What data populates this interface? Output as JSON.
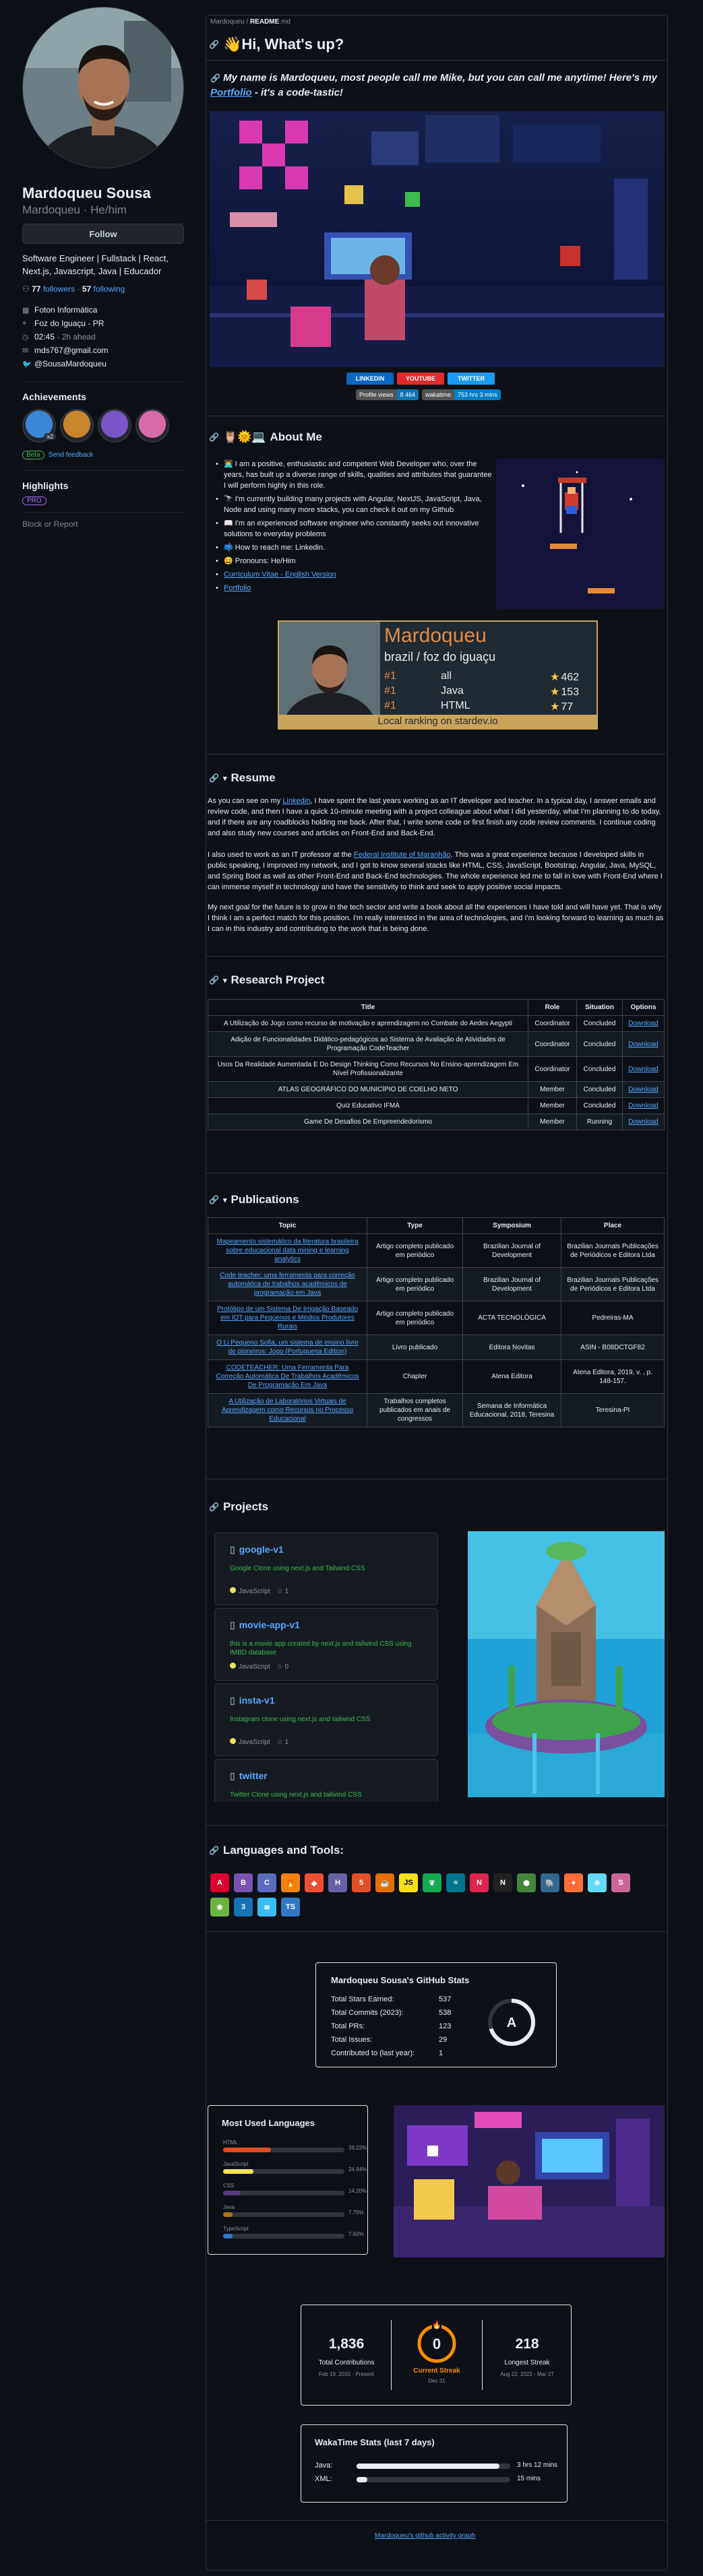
{
  "profile": {
    "name": "Mardoqueu Sousa",
    "login": "Mardoqueu · He/him",
    "follow_label": "Follow",
    "bio": "Software Engineer | Fullstack | React, Next.js, Javascript, Java | Educador",
    "followers": "77",
    "followers_label": "followers",
    "following": "57",
    "following_label": "following",
    "company": "Foton Informática",
    "location": "Foz do Iguaçu - PR",
    "time": "02:45",
    "time_note": "- 2h ahead",
    "email": "mds767@gmail.com",
    "twitter": "@SousaMardoqueu",
    "achievements_title": "Achievements",
    "achievement_badges": [
      {
        "name": "pull-shark",
        "count": "x2",
        "color": "#3a87d6"
      },
      {
        "name": "yolo",
        "count": "",
        "color": "#c7862d"
      },
      {
        "name": "quickdraw",
        "count": "",
        "color": "#7b56c8"
      },
      {
        "name": "starstruck",
        "count": "",
        "color": "#d86aa9"
      }
    ],
    "beta_label": "Beta",
    "feedback_label": "Send feedback",
    "highlights_title": "Highlights",
    "pro_label": "PRO",
    "report_label": "Block or Report"
  },
  "readme": {
    "breadcrumb_user": "Mardoqueu",
    "breadcrumb_sep": " / ",
    "breadcrumb_file": "README",
    "breadcrumb_ext": ".md",
    "title": "👋Hi, What's up?",
    "intro_a": "My name is Mardoqueu, most people call me Mike, but you can call me anytime! Here's my ",
    "intro_link": "Portfolio",
    "intro_b": " - it's a code-tastic!",
    "social": [
      {
        "label": "LINKEDIN",
        "color": "#0a66c2"
      },
      {
        "label": "YOUTUBE",
        "color": "#e02b2b"
      },
      {
        "label": "TWITTER",
        "color": "#1d9bf0"
      }
    ],
    "profile_views_label": "Profile views",
    "profile_views_value": "8 464",
    "wakatime_label": "wakatime",
    "wakatime_value": "753 hrs 3 mins"
  },
  "about": {
    "title": "About Me",
    "items": [
      "👨‍💻 I am a positive, enthusiastic and competent Web Developer who, over the years, has built up a diverse range of skills, qualities and attributes that guarantee I will perform highly in this role.",
      "🔭 I'm currently building many projects with Angular, NextJS, JavaScript, Java, Node and using many more stacks, you can check it out on my Github",
      "📖 I'm an experienced software engineer who constantly seeks out innovative solutions to everyday problems",
      "📫 How to reach me: Linkedin.",
      "😄 Pronouns: He/Him",
      "Curriculum Vitae - English Version",
      "Portfolio"
    ],
    "stardev": {
      "name": "Mardoqueu",
      "location": "brazil / foz do iguaçu",
      "rows": [
        {
          "rank": "#1",
          "lang": "all",
          "count": "462"
        },
        {
          "rank": "#1",
          "lang": "Java",
          "count": "153"
        },
        {
          "rank": "#1",
          "lang": "HTML",
          "count": "77"
        }
      ],
      "footer": "Local ranking on stardev.io"
    }
  },
  "resume": {
    "title": "Resume",
    "p1_a": "As you can see on my ",
    "p1_link": "Linkedin",
    "p1_b": ", I have spent the last years working as an IT developer and teacher. In a typical day, I answer emails and review code, and then I have a quick 10-minute meeting with a project colleague about what I did yesterday, what I'm planning to do today, and if there are any roadblocks holding me back. After that, I write some code or first finish any code review comments. I continue coding and also study new courses and articles on Front-End and Back-End.",
    "p2_a": "I also used to work as an IT professor at the ",
    "p2_link": "Federal Institute of Maranhão",
    "p2_b": ". This was a great experience because I developed skills in public speaking, I improved my network, and I got to know several stacks like HTML, CSS, JavaScript, Bootstrap, Angular, Java, MySQL, and Spring Boot as well as other Front-End and Back-End technologies. The whole experience led me to fall in love with Front-End where I can immerse myself in technology and have the sensitivity to think and seek to apply positive social impacts.",
    "p3": "My next goal for the future is to grow in the tech sector and write a book about all the experiences I have told and will have yet. That is why I think I am a perfect match for this position. I'm really interested in the area of technologies, and I'm looking forward to learning as much as I can in this industry and contributing to the work that is being done."
  },
  "research": {
    "title": "Research Project",
    "headers": [
      "Title",
      "Role",
      "Situation",
      "Options"
    ],
    "rows": [
      [
        "A Utilização do Jogo como recurso de motivação e aprendizagem no Combate do Aedes Aegypti",
        "Coordinator",
        "Concluded",
        "Download"
      ],
      [
        "Adição de Funcionalidades Didático-pedagógicos ao Sistema de Avaliação de Atividades de Programação CodeTeacher",
        "Coordinator",
        "Concluded",
        "Download"
      ],
      [
        "Usos Da Realidade Aumentada E Do Design Thinking Como Recursos No Ensino-aprendizagem Em Nível Profissionalizante",
        "Coordinator",
        "Concluded",
        "Download"
      ],
      [
        "ATLAS GEOGRÁFICO DO MUNICÍPIO DE COELHO NETO",
        "Member",
        "Concluded",
        "Download"
      ],
      [
        "Quiz Educativo IFMA",
        "Member",
        "Concluded",
        "Download"
      ],
      [
        "Game De Desafios De Empreendedorismo",
        "Member",
        "Running",
        "Download"
      ]
    ]
  },
  "publications": {
    "title": "Publications",
    "headers": [
      "Topic",
      "Type",
      "Symposium",
      "Place"
    ],
    "rows": [
      [
        "Mapeamento sistemático da literatura brasileira sobre educacional data mining e learning analytics",
        "Artigo completo publicado em periódico",
        "Brazilian Journal of Development",
        "Brazilian Journals Publicações de Periódicos e Editora Ltda"
      ],
      [
        "Code teacher: uma ferramenta para correção automática de trabalhos acadêmicos de programação em Java",
        "Artigo completo publicado em periódico",
        "Brazilian Journal of Development",
        "Brazilian Journals Publicações de Periódicos e Editora Ltda"
      ],
      [
        "Protótipo de um Sistema De Irrigação Baseado em IOT para Pequenos e Médios Produtores Rurais",
        "Artigo completo publicado em periódico",
        "ACTA TECNOLÓGICA",
        "Pedreiras-MA"
      ],
      [
        "O Li Pequeno Sofia, um sistema de ensino livre de pioneiros: Jogo (Portuguesa Edition)",
        "Livro publicado",
        "Editora Novitas",
        "ASIN - B08DCTGF82"
      ],
      [
        "CODETEACHER: Uma Ferramenta Para Correção Automática De Trabalhos Acadêmicos De Programação Em Java",
        "Chapter",
        "Atena Editora",
        "Atena Editora, 2019, v. , p. 148-157."
      ],
      [
        "A Utilização de Laboratórios Virtuais de Aprendizagem como Recursos no Processo Educacional",
        "Trabalhos completos publicados em anais de congressos",
        "Semana de Informática Educacional, 2018, Teresina",
        "Teresina-PI"
      ]
    ]
  },
  "projects": {
    "title": "Projects",
    "cards": [
      {
        "name": "google-v1",
        "desc": "Google Clone using next.js and Tailwind CSS",
        "lang": "JavaScript",
        "stars": "1"
      },
      {
        "name": "movie-app-v1",
        "desc": "this is a movie app created by next.js and tailwind CSS using IMBD database",
        "lang": "JavaScript",
        "stars": "0"
      },
      {
        "name": "insta-v1",
        "desc": "Instagram clone using next.js and tailwind CSS",
        "lang": "JavaScript",
        "stars": "1"
      },
      {
        "name": "twitter",
        "desc": "Twitter Clone using next.js and tailwind CSS",
        "lang": "",
        "stars": ""
      }
    ]
  },
  "tools": {
    "title": "Languages and Tools:",
    "icons": [
      {
        "name": "angular-icon",
        "glyph": "A",
        "color": "#dd0031"
      },
      {
        "name": "bootstrap-icon",
        "glyph": "B",
        "color": "#7952b3"
      },
      {
        "name": "c-icon",
        "glyph": "C",
        "color": "#5c6bc0"
      },
      {
        "name": "firebase-icon",
        "glyph": "🔥",
        "color": "#f5820d"
      },
      {
        "name": "git-icon",
        "glyph": "◆",
        "color": "#f05032"
      },
      {
        "name": "heroku-icon",
        "glyph": "H",
        "color": "#6762a6"
      },
      {
        "name": "html5-icon",
        "glyph": "5",
        "color": "#e34f26"
      },
      {
        "name": "java-icon",
        "glyph": "☕",
        "color": "#e76f00"
      },
      {
        "name": "javascript-icon",
        "glyph": "JS",
        "color": "#f7df1e"
      },
      {
        "name": "mongodb-icon",
        "glyph": "❦",
        "color": "#13aa52"
      },
      {
        "name": "mysql-icon",
        "glyph": "≈",
        "color": "#00758f"
      },
      {
        "name": "nestjs-icon",
        "glyph": "N",
        "color": "#e0234e"
      },
      {
        "name": "nextjs-icon",
        "glyph": "N",
        "color": "#222222"
      },
      {
        "name": "nodejs-icon",
        "glyph": "⬢",
        "color": "#43853d"
      },
      {
        "name": "postgresql-icon",
        "glyph": "🐘",
        "color": "#336791"
      },
      {
        "name": "postman-icon",
        "glyph": "●",
        "color": "#ff6c37"
      },
      {
        "name": "react-icon",
        "glyph": "⚛",
        "color": "#61dafb"
      },
      {
        "name": "sass-icon",
        "glyph": "S",
        "color": "#cc6699"
      },
      {
        "name": "spring-icon",
        "glyph": "❀",
        "color": "#6db33f"
      },
      {
        "name": "css3-icon",
        "glyph": "3",
        "color": "#1572b6"
      },
      {
        "name": "tailwind-icon",
        "glyph": "≋",
        "color": "#38bdf8"
      },
      {
        "name": "typescript-icon",
        "glyph": "TS",
        "color": "#3178c6"
      }
    ]
  },
  "github_stats": {
    "title": "Mardoqueu Sousa's GitHub Stats",
    "rows": [
      {
        "label": "Total Stars Earned:",
        "value": "537"
      },
      {
        "label": "Total Commits (2023):",
        "value": "538"
      },
      {
        "label": "Total PRs:",
        "value": "123"
      },
      {
        "label": "Total Issues:",
        "value": "29"
      },
      {
        "label": "Contributed to (last year):",
        "value": "1"
      }
    ],
    "grade": "A",
    "grade_fraction": 0.7
  },
  "top_langs": {
    "title": "Most Used Languages",
    "langs": [
      {
        "name": "HTML",
        "pct": "39.22%",
        "frac": 0.3922,
        "color": "#e34c26"
      },
      {
        "name": "JavaScript",
        "pct": "24.94%",
        "frac": 0.2494,
        "color": "#f1e05a"
      },
      {
        "name": "CSS",
        "pct": "14.20%",
        "frac": 0.142,
        "color": "#563d7c"
      },
      {
        "name": "Java",
        "pct": "7.75%",
        "frac": 0.0775,
        "color": "#b07219"
      },
      {
        "name": "TypeScript",
        "pct": "7.60%",
        "frac": 0.076,
        "color": "#3178c6"
      }
    ]
  },
  "streak": {
    "total": "1,836",
    "total_label": "Total Contributions",
    "total_range": "Feb 19, 2015 - Present",
    "current": "0",
    "current_label": "Current Streak",
    "current_date": "Dec 31",
    "longest": "218",
    "longest_label": "Longest Streak",
    "longest_range": "Aug 22, 2022 - Mar 27"
  },
  "wakatime": {
    "title": "WakaTime Stats (last 7 days)",
    "rows": [
      {
        "lang": "Java:",
        "time": "3 hrs 12 mins",
        "frac": 0.93
      },
      {
        "lang": "XML:",
        "time": "15 mins",
        "frac": 0.07
      }
    ]
  },
  "activity_graph_label": "Mardoqueu's github activity graph",
  "colors": {
    "bg": "#0d1117",
    "link": "#58a6ff",
    "streak_orange": "#fb8c00"
  }
}
